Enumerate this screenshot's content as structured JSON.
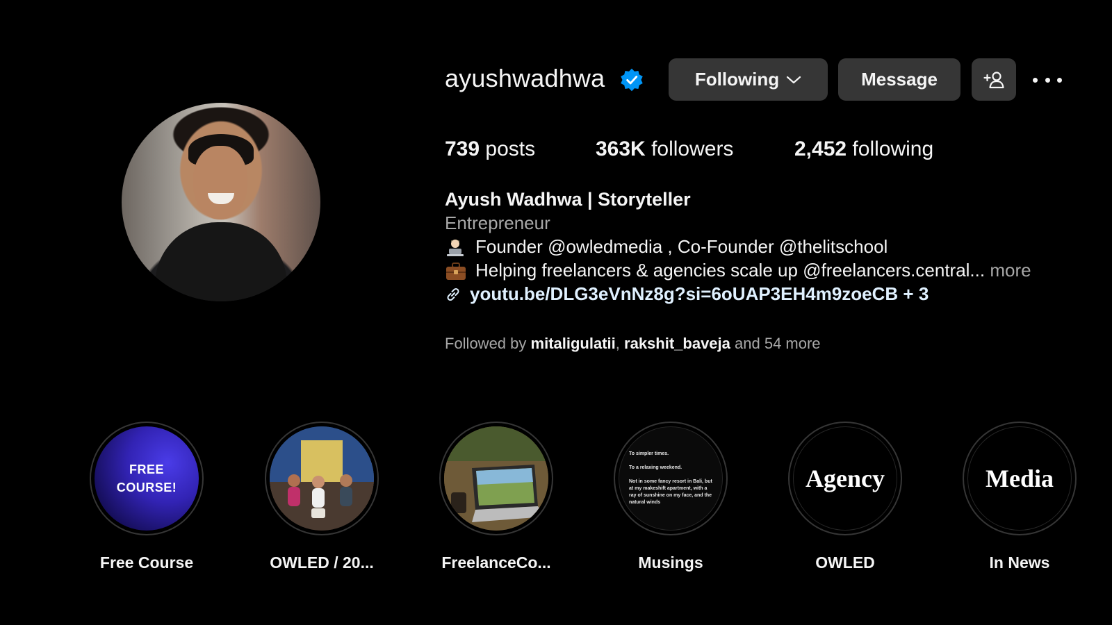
{
  "profile": {
    "username": "ayushwadhwa",
    "buttons": {
      "following": "Following",
      "message": "Message"
    },
    "stats": {
      "posts_count": "739",
      "posts_label": "posts",
      "followers_count": "363K",
      "followers_label": "followers",
      "following_count": "2,452",
      "following_label": "following"
    },
    "bio": {
      "name": "Ayush Wadhwa | Storyteller",
      "category": "Entrepreneur",
      "line1": "Founder @owledmedia , Co-Founder @thelitschool",
      "line2": "Helping freelancers & agencies scale up @freelancers.central...",
      "more": "more",
      "link": "youtu.be/DLG3eVnNz8g?si=6oUAP3EH4m9zoeCB + 3"
    },
    "followed_by": {
      "prefix": "Followed by",
      "user1": "mitaligulatii",
      "separator": ",",
      "user2": "rakshit_baveja",
      "suffix": "and 54 more"
    }
  },
  "highlights": [
    {
      "label": "Free Course",
      "cover_text": "FREE\nCOURSE!"
    },
    {
      "label": "OWLED / 20..."
    },
    {
      "label": "FreelanceCo..."
    },
    {
      "label": "Musings",
      "cover_text": "To simpler times.\n\nTo a relaxing weekend.\n\nNot in some fancy resort in Bali, but at my makeshift apartment, with a ray of sunshine on my face, and the natural winds"
    },
    {
      "label": "OWLED",
      "cover_text": "Agency"
    },
    {
      "label": "In News",
      "cover_text": "Media"
    }
  ],
  "colors": {
    "background": "#000000",
    "button_bg": "#363636",
    "verified_blue": "#0095f6",
    "muted_text": "#a8a8a8",
    "link_text": "#e0f1ff"
  },
  "icons": [
    "verified-badge-icon",
    "chevron-down-icon",
    "add-user-icon",
    "more-options-icon",
    "link-icon"
  ]
}
